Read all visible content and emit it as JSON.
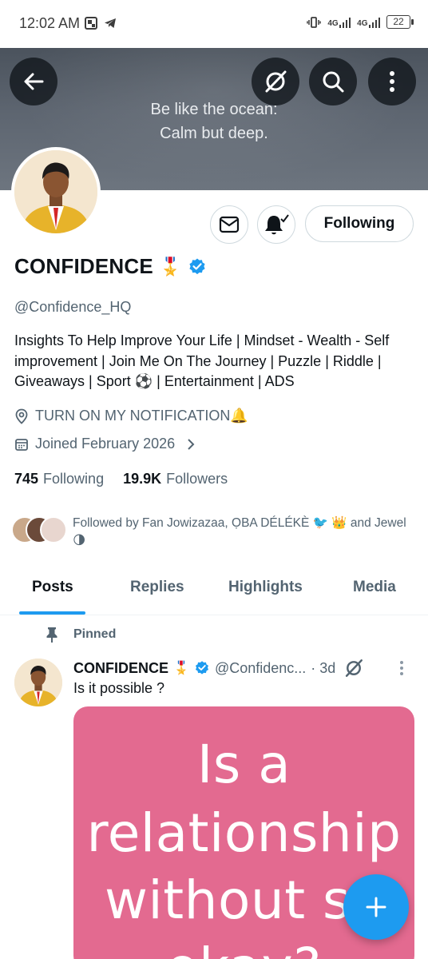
{
  "status_bar": {
    "time": "12:02 AM",
    "network1": "4G",
    "network2": "4G",
    "battery": "22"
  },
  "banner": {
    "quote_line1": "Be like the ocean:",
    "quote_line2": "Calm but deep."
  },
  "profile": {
    "name": "CONFIDENCE",
    "name_emoji": "🎖️",
    "handle": "@Confidence_HQ",
    "bio": "Insights To Help Improve Your Life | Mindset - Wealth - Self improvement | Join Me On The Journey | Puzzle | Riddle | Giveaways | Sport ⚽ | Entertainment | ADS",
    "location": "TURN ON MY NOTIFICATION🔔",
    "joined": "Joined February 2026",
    "following_count": "745",
    "following_label": "Following",
    "followers_count": "19.9K",
    "followers_label": "Followers",
    "follow_button": "Following",
    "followed_by": "Followed by Fan Jowizazaa, ỌBA DÉLÉKÈ 🐦 👑 and Jewel 🌗"
  },
  "tabs": [
    {
      "label": "Posts"
    },
    {
      "label": "Replies"
    },
    {
      "label": "Highlights"
    },
    {
      "label": "Media"
    }
  ],
  "post": {
    "pinned_label": "Pinned",
    "author": "CONFIDENCE",
    "author_emoji": "🎖️",
    "handle": "@Confidenc...",
    "time": "· 3d",
    "text": "Is it possible ?",
    "image_line1": "Is a",
    "image_line2": "relationship",
    "image_line3": "without se",
    "image_line4": "okay?"
  },
  "colors": {
    "accent": "#1d9bf0",
    "banner": "#5d6570",
    "post_image_bg": "#e36a90"
  },
  "icons": [
    "back-icon",
    "grok-icon",
    "search-icon",
    "more-vertical-icon",
    "mail-icon",
    "bell-check-icon",
    "verified-badge-icon",
    "location-icon",
    "calendar-icon",
    "chevron-right-icon",
    "pin-icon",
    "compose-plus-icon"
  ]
}
